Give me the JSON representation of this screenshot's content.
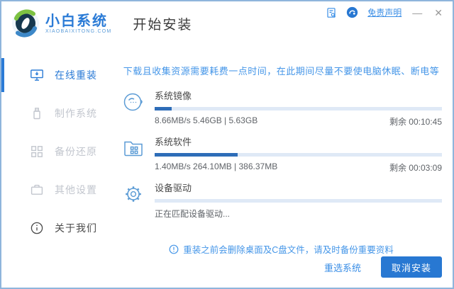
{
  "header": {
    "logo_title": "小白系统",
    "logo_subtitle": "XIAOBAIXITONG.COM",
    "page_title": "开始安装",
    "disclaimer_label": "免责声明",
    "minimize_glyph": "—",
    "close_glyph": "✕"
  },
  "sidebar": {
    "items": [
      {
        "label": "在线重装",
        "active": true
      },
      {
        "label": "制作系统",
        "active": false
      },
      {
        "label": "备份还原",
        "active": false
      },
      {
        "label": "其他设置",
        "active": false
      },
      {
        "label": "关于我们",
        "active": false
      }
    ]
  },
  "main": {
    "warning": "下载且收集资源需要耗费一点时间，在此期间尽量不要使电脑休眠、断电等",
    "tasks": [
      {
        "name": "系统镜像",
        "icon": "mascot-face-icon",
        "progress_percent": 6,
        "stats": "8.66MB/s 5.46GB | 5.63GB",
        "remaining": "剩余 00:10:45"
      },
      {
        "name": "系统软件",
        "icon": "folder-apps-icon",
        "progress_percent": 29,
        "stats": "1.40MB/s 264.10MB | 386.37MB",
        "remaining": "剩余 00:03:09"
      },
      {
        "name": "设备驱动",
        "icon": "gear-icon",
        "progress_percent": 0,
        "stats": "正在匹配设备驱动...",
        "remaining": ""
      }
    ],
    "note": "重装之前会删除桌面及C盘文件，请及时备份重要资料",
    "reselect_label": "重选系统",
    "cancel_label": "取消安装"
  },
  "colors": {
    "accent": "#2878d2",
    "sidebar_active": "#2b7bd6",
    "progress_fill": "#2e6db8",
    "progress_track": "#dfe9f6",
    "info_text": "#4596e8",
    "window_border": "#8fb5dc"
  }
}
